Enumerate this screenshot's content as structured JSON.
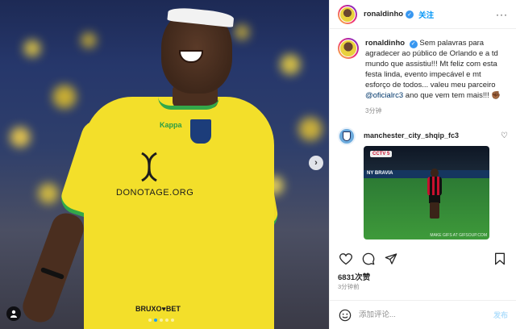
{
  "media": {
    "jersey_sponsor": "DONOTAGE.ORG",
    "jersey_sponsor_bottom": "BRUXO♥BET",
    "kit_brand": "Kappa",
    "carousel_next_icon": "chevron-right-icon",
    "tag_icon": "person-icon",
    "carousel_dots": 5,
    "carousel_active_dot": 1
  },
  "header": {
    "username": "ronaldinho",
    "verified": true,
    "follow_label": "关注",
    "more_label": "···"
  },
  "caption": {
    "username": "ronaldinho",
    "text_before_mention": "Sem palavras para agradecer ao público de Orlando e a td mundo que assistiu!!! Mt feliz com esta festa linda, evento impecável e mt esforço de todos... valeu meu parceiro ",
    "mention": "@oficialrc3",
    "text_after_mention": " ano que vem tem mais!!! ✊🏾",
    "time": "3分钟"
  },
  "comment": {
    "username": "manchester_city_shqip_fc3",
    "gif_broadcaster": "CCTV 5",
    "gif_ad_text": "NY BRAVIA",
    "gif_watermark": "MAKE GIFS AT GIFSOUP.COM"
  },
  "actions": {
    "like_icon": "heart-icon",
    "comment_icon": "comment-icon",
    "share_icon": "send-icon",
    "save_icon": "bookmark-icon"
  },
  "likes_text": "6831次赞",
  "post_time": "3分钟前",
  "composer": {
    "placeholder": "添加评论...",
    "post_label": "发布"
  },
  "colors": {
    "accent": "#0095f6",
    "verified": "#3897f0",
    "jersey": "#f3df2a",
    "trim": "#33a84a"
  }
}
